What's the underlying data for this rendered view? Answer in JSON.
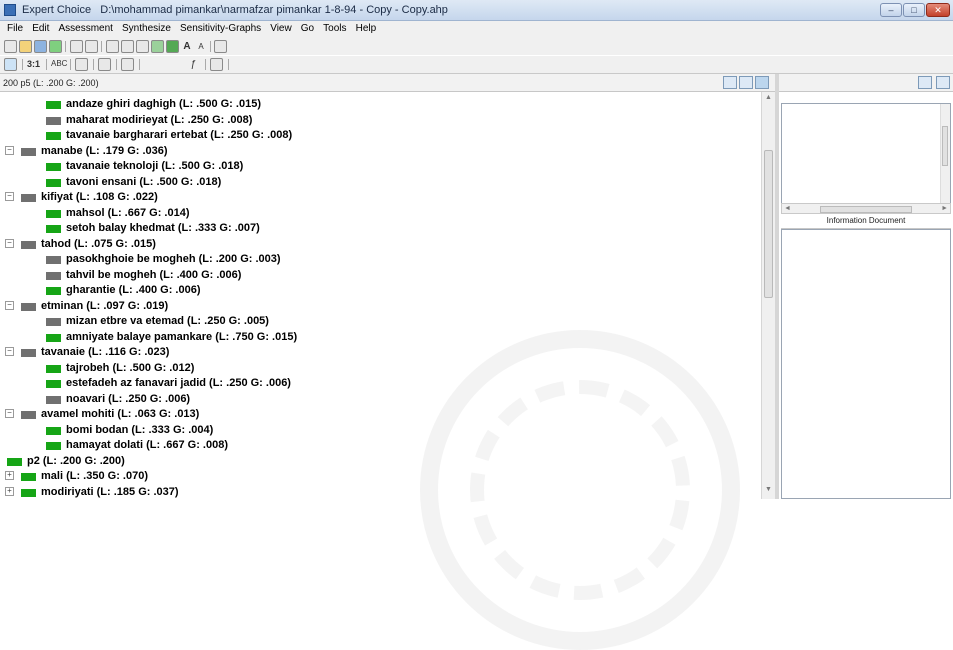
{
  "window": {
    "app": "Expert Choice",
    "file": "D:\\mohammad pimankar\\narmafzar pimankar 1-8-94 - Copy - Copy.ahp",
    "min_glyph": "–",
    "max_glyph": "□",
    "close_glyph": "✕"
  },
  "menu": [
    "File",
    "Edit",
    "Assessment",
    "Synthesize",
    "Sensitivity-Graphs",
    "View",
    "Go",
    "Tools",
    "Help"
  ],
  "toolbar2": {
    "ratio": "3:1",
    "abc": "ABC"
  },
  "node_path": "200  p5 (L: .200 G: .200)",
  "right_panel": {
    "info_label": "Information Document"
  },
  "tree": [
    {
      "text": "andaze ghiri daghigh (L: .500 G: .015)",
      "color": "green"
    },
    {
      "text": "maharat modirieyat (L: .250 G: .008)",
      "color": "gray"
    },
    {
      "text": "tavanaie bargharari ertebat (L: .250 G: .008)",
      "color": "green"
    },
    {
      "text": "manabe (L: .179 G: .036)",
      "color": "gray"
    },
    {
      "text": "tavanaie teknoloji (L: .500 G: .018)",
      "color": "green"
    },
    {
      "text": "tavoni ensani (L: .500 G: .018)",
      "color": "green"
    },
    {
      "text": "kifiyat (L: .108 G: .022)",
      "color": "gray"
    },
    {
      "text": "mahsol (L: .667 G: .014)",
      "color": "green"
    },
    {
      "text": "setoh balay khedmat (L: .333 G: .007)",
      "color": "green"
    },
    {
      "text": "tahod (L: .075 G: .015)",
      "color": "gray"
    },
    {
      "text": "pasokhghoie be mogheh (L: .200 G: .003)",
      "color": "gray"
    },
    {
      "text": "tahvil be mogheh (L: .400 G: .006)",
      "color": "gray"
    },
    {
      "text": "gharantie (L: .400 G: .006)",
      "color": "green"
    },
    {
      "text": "etminan (L: .097 G: .019)",
      "color": "gray"
    },
    {
      "text": "mizan etbre va etemad (L: .250 G: .005)",
      "color": "gray"
    },
    {
      "text": "amniyate balaye pamankare (L: .750 G: .015)",
      "color": "green"
    },
    {
      "text": "tavanaie (L: .116 G: .023)",
      "color": "gray"
    },
    {
      "text": "tajrobeh (L: .500 G: .012)",
      "color": "green"
    },
    {
      "text": "estefadeh az fanavari jadid (L: .250 G: .006)",
      "color": "green"
    },
    {
      "text": "noavari (L: .250 G: .006)",
      "color": "gray"
    },
    {
      "text": "avamel mohiti (L: .063 G: .013)",
      "color": "gray"
    },
    {
      "text": "bomi bodan (L: .333 G: .004)",
      "color": "green"
    },
    {
      "text": "hamayat dolati (L: .667 G: .008)",
      "color": "green"
    },
    {
      "text": "p2 (L: .200 G: .200)",
      "color": "green"
    },
    {
      "text": "mali (L: .350 G: .070)",
      "color": "green"
    },
    {
      "text": "modiriyati (L: .185 G: .037)",
      "color": "green"
    }
  ]
}
